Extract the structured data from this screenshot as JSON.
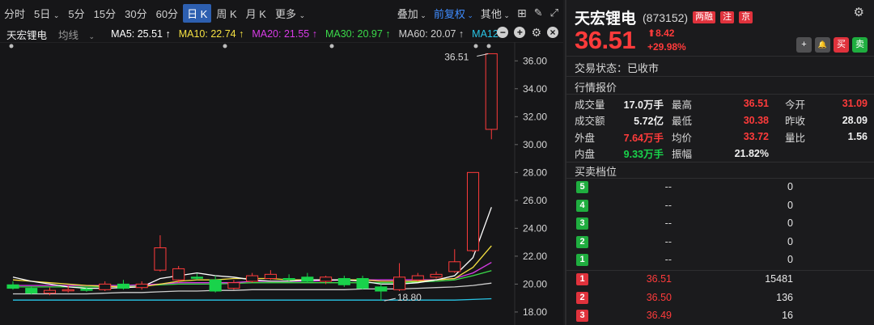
{
  "toolbar": {
    "periods": [
      "分时",
      "5日",
      "5分",
      "15分",
      "30分",
      "60分",
      "日 K",
      "周 K",
      "月 K",
      "更多"
    ],
    "active": "日 K",
    "overlay": "叠加",
    "adjust": "前复权",
    "other": "其他"
  },
  "indicators": {
    "stock_name": "天宏锂电",
    "avg_line": "均线",
    "ma5": "MA5: 25.51 ↑",
    "ma10": "MA10: 22.74 ↑",
    "ma20": "MA20: 21.55 ↑",
    "ma30": "MA30: 20.97 ↑",
    "ma60": "MA60: 20.07 ↑",
    "ma12": "MA12",
    "colors": {
      "ma5": "#ffffff",
      "ma10": "#f5e142",
      "ma20": "#d93be8",
      "ma30": "#3bdb4a",
      "ma60": "#cfcfcf",
      "ma12": "#29c5e6"
    }
  },
  "chart_data": {
    "type": "candlestick",
    "y_ticks": [
      "36.00",
      "34.00",
      "32.00",
      "30.00",
      "28.00",
      "26.00",
      "24.00",
      "22.00",
      "20.00",
      "18.00"
    ],
    "ylim": [
      17.3,
      37.0
    ],
    "high_label": "36.51",
    "low_label": "18.80",
    "up_color": "#ff3b3b",
    "down_color": "#19d34b",
    "candles": [
      {
        "o": 19.95,
        "c": 19.7,
        "h": 20.2,
        "l": 19.6
      },
      {
        "o": 19.7,
        "c": 19.35,
        "h": 19.85,
        "l": 19.25
      },
      {
        "o": 19.35,
        "c": 19.55,
        "h": 19.75,
        "l": 19.2
      },
      {
        "o": 19.55,
        "c": 19.6,
        "h": 19.9,
        "l": 19.4
      },
      {
        "o": 19.65,
        "c": 19.55,
        "h": 19.8,
        "l": 19.45
      },
      {
        "o": 19.6,
        "c": 20.0,
        "h": 20.2,
        "l": 19.5
      },
      {
        "o": 20.0,
        "c": 19.7,
        "h": 20.3,
        "l": 19.6
      },
      {
        "o": 19.75,
        "c": 20.0,
        "h": 20.2,
        "l": 19.6
      },
      {
        "o": 21.0,
        "c": 22.6,
        "h": 23.5,
        "l": 20.9
      },
      {
        "o": 20.3,
        "c": 21.1,
        "h": 21.3,
        "l": 20.1
      },
      {
        "o": 20.5,
        "c": 20.45,
        "h": 20.75,
        "l": 20.3
      },
      {
        "o": 20.3,
        "c": 19.5,
        "h": 20.6,
        "l": 19.4
      },
      {
        "o": 19.7,
        "c": 20.1,
        "h": 20.3,
        "l": 19.6
      },
      {
        "o": 20.2,
        "c": 20.6,
        "h": 20.8,
        "l": 20.1
      },
      {
        "o": 20.4,
        "c": 20.7,
        "h": 21.0,
        "l": 20.3
      },
      {
        "o": 20.4,
        "c": 20.35,
        "h": 20.7,
        "l": 20.2
      },
      {
        "o": 20.5,
        "c": 20.2,
        "h": 20.8,
        "l": 20.1
      },
      {
        "o": 20.2,
        "c": 20.5,
        "h": 20.6,
        "l": 20.0
      },
      {
        "o": 20.4,
        "c": 19.95,
        "h": 20.6,
        "l": 19.8
      },
      {
        "o": 20.4,
        "c": 19.7,
        "h": 20.6,
        "l": 19.6
      },
      {
        "o": 19.8,
        "c": 19.5,
        "h": 20.0,
        "l": 18.8
      },
      {
        "o": 19.6,
        "c": 20.5,
        "h": 21.5,
        "l": 19.5
      },
      {
        "o": 20.3,
        "c": 20.6,
        "h": 20.8,
        "l": 20.2
      },
      {
        "o": 20.5,
        "c": 20.7,
        "h": 20.9,
        "l": 20.4
      },
      {
        "o": 20.9,
        "c": 21.6,
        "h": 22.5,
        "l": 20.8
      },
      {
        "o": 22.4,
        "c": 28.0,
        "h": 28.0,
        "l": 22.3
      },
      {
        "o": 31.09,
        "c": 36.51,
        "h": 36.51,
        "l": 30.38
      }
    ],
    "ma_series": {
      "ma5": [
        20.5,
        20.2,
        20.0,
        19.8,
        19.7,
        19.7,
        19.75,
        19.8,
        20.4,
        20.6,
        20.8,
        20.6,
        20.5,
        20.3,
        20.2,
        20.2,
        20.3,
        20.3,
        20.3,
        20.2,
        20.0,
        20.0,
        20.1,
        20.3,
        20.6,
        21.9,
        25.51
      ],
      "ma10": [
        20.3,
        20.2,
        20.1,
        20.0,
        19.9,
        19.85,
        19.8,
        19.8,
        20.0,
        20.2,
        20.3,
        20.3,
        20.4,
        20.4,
        20.4,
        20.3,
        20.3,
        20.3,
        20.3,
        20.3,
        20.2,
        20.2,
        20.2,
        20.3,
        20.4,
        21.2,
        22.74
      ],
      "ma20": [
        19.9,
        19.9,
        19.9,
        19.9,
        19.9,
        19.9,
        19.9,
        19.95,
        20.0,
        20.1,
        20.1,
        20.1,
        20.1,
        20.2,
        20.2,
        20.2,
        20.2,
        20.25,
        20.3,
        20.3,
        20.3,
        20.3,
        20.3,
        20.3,
        20.4,
        20.8,
        21.55
      ],
      "ma30": [
        19.8,
        19.8,
        19.8,
        19.8,
        19.8,
        19.8,
        19.85,
        19.9,
        19.95,
        20.0,
        20.0,
        20.0,
        20.05,
        20.1,
        20.1,
        20.1,
        20.1,
        20.1,
        20.1,
        20.1,
        20.1,
        20.1,
        20.15,
        20.2,
        20.3,
        20.6,
        20.97
      ],
      "ma60": [
        19.3,
        19.3,
        19.3,
        19.3,
        19.3,
        19.35,
        19.4,
        19.4,
        19.45,
        19.5,
        19.5,
        19.55,
        19.55,
        19.6,
        19.6,
        19.6,
        19.6,
        19.6,
        19.6,
        19.65,
        19.65,
        19.65,
        19.7,
        19.75,
        19.8,
        19.9,
        20.07
      ],
      "ma12": [
        18.85,
        18.85,
        18.85,
        18.85,
        18.85,
        18.85,
        18.85,
        18.85,
        18.85,
        18.85,
        18.85,
        18.85,
        18.85,
        18.85,
        18.85,
        18.85,
        18.85,
        18.85,
        18.85,
        18.85,
        18.85,
        18.85,
        18.85,
        18.85,
        18.85,
        18.9,
        18.95
      ]
    }
  },
  "stock": {
    "name": "天宏锂电",
    "code": "(873152)",
    "tags": [
      "两融",
      "注",
      "京"
    ],
    "price": "36.51",
    "change": "8.42",
    "change_pct": "+29.98%",
    "status": "交易状态：已收市",
    "actions": [
      "+",
      "🔔",
      "买",
      "卖"
    ]
  },
  "quote": {
    "title": "行情报价",
    "rows": [
      {
        "l1": "成交量",
        "v1": "17.0万手",
        "c1": "white",
        "l2": "最高",
        "v2": "36.51",
        "c2": "red",
        "l3": "今开",
        "v3": "31.09",
        "c3": "red"
      },
      {
        "l1": "成交额",
        "v1": "5.72亿",
        "c1": "white",
        "l2": "最低",
        "v2": "30.38",
        "c2": "red",
        "l3": "昨收",
        "v3": "28.09",
        "c3": "white"
      },
      {
        "l1": "外盘",
        "v1": "7.64万手",
        "c1": "red",
        "l2": "均价",
        "v2": "33.72",
        "c2": "red",
        "l3": "量比",
        "v3": "1.56",
        "c3": "white"
      },
      {
        "l1": "内盘",
        "v1": "9.33万手",
        "c1": "green",
        "l2": "振幅",
        "v2": "21.82%",
        "c2": "white",
        "l3": "",
        "v3": "",
        "c3": "white"
      }
    ]
  },
  "orderbook": {
    "title": "买卖档位",
    "sell": [
      {
        "n": "5",
        "p": "--",
        "v": "0"
      },
      {
        "n": "4",
        "p": "--",
        "v": "0"
      },
      {
        "n": "3",
        "p": "--",
        "v": "0"
      },
      {
        "n": "2",
        "p": "--",
        "v": "0"
      },
      {
        "n": "1",
        "p": "--",
        "v": "0"
      }
    ],
    "buy": [
      {
        "n": "1",
        "p": "36.51",
        "v": "15481"
      },
      {
        "n": "2",
        "p": "36.50",
        "v": "136"
      },
      {
        "n": "3",
        "p": "36.49",
        "v": "16"
      }
    ]
  }
}
